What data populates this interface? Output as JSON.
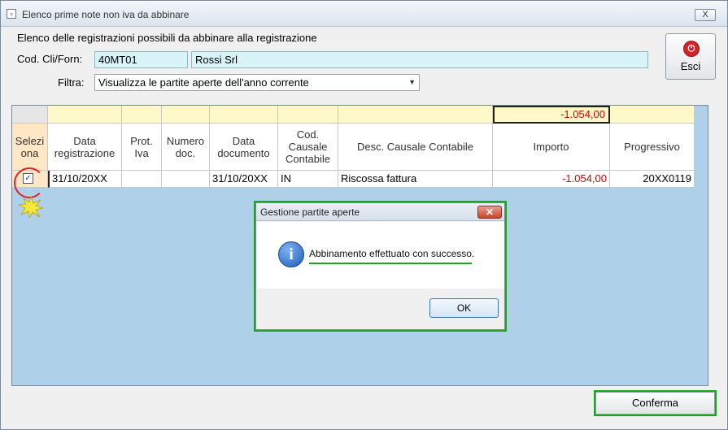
{
  "window": {
    "title": "Elenco prime note non iva da abbinare",
    "close_label": "X"
  },
  "heading": "Elenco delle registrazioni possibili da abbinare alla registrazione",
  "cod_cli": {
    "label": "Cod. Cli/Forn:",
    "code": "40MT01",
    "name": "Rossi Srl"
  },
  "filter": {
    "label": "Filtra:",
    "value": "Visualizza le partite aperte dell'anno corrente"
  },
  "esci": {
    "label": "Esci",
    "icon": "power-icon"
  },
  "grid": {
    "total": "-1.054,00",
    "headers": [
      "Selezi ona",
      "Data registrazione",
      "Prot. Iva",
      "Numero doc.",
      "Data documento",
      "Cod. Causale Contabile",
      "Desc. Causale Contabile",
      "Importo",
      "Progressivo"
    ],
    "rows": [
      {
        "selected": true,
        "data_registrazione": "31/10/20XX",
        "prot_iva": "",
        "numero_doc": "",
        "data_documento": "31/10/20XX",
        "cod_causale": "IN",
        "desc_causale": "Riscossa fattura",
        "importo": "-1.054,00",
        "progressivo": "20XX0119"
      }
    ]
  },
  "dialog": {
    "title": "Gestione partite aperte",
    "message": "Abbinamento effettuato con successo.",
    "ok_label": "OK",
    "icon": "info-icon"
  },
  "confirm_label": "Conferma",
  "colors": {
    "highlight_green": "#1aa81a",
    "negative_red": "#d40000",
    "grid_bg": "#aed0e8",
    "total_row": "#fff8c8",
    "field_bg": "#d9f4f8"
  }
}
